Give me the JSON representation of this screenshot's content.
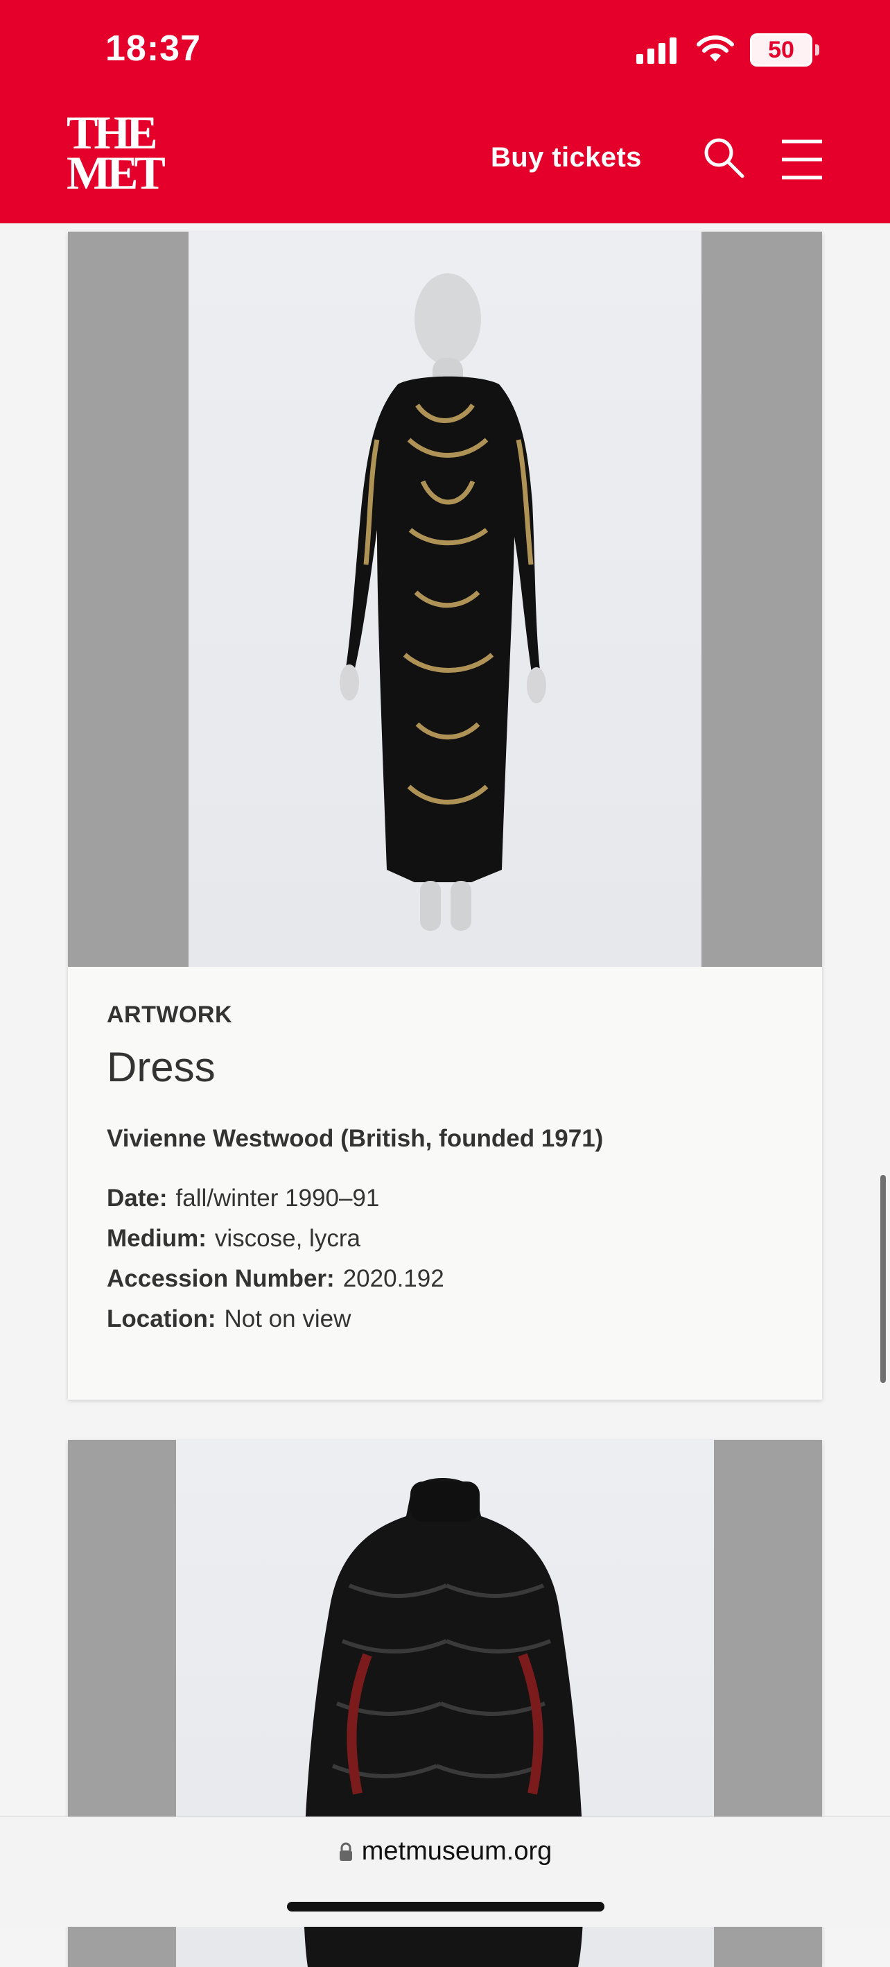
{
  "status_bar": {
    "time": "18:37",
    "battery": "50"
  },
  "header": {
    "logo_line1": "THE",
    "logo_line2": "MET",
    "buy_tickets": "Buy tickets",
    "icons": [
      "search-icon",
      "menu-icon"
    ],
    "colors": {
      "brand": "#e4002b"
    }
  },
  "cards": [
    {
      "label": "ARTWORK",
      "title": "Dress",
      "maker": "Vivienne Westwood (British, founded 1971)",
      "facts": [
        {
          "label": "Date:",
          "value": "fall/winter 1990–91"
        },
        {
          "label": "Medium:",
          "value": "viscose, lycra"
        },
        {
          "label": "Accession Number:",
          "value": "2020.192"
        },
        {
          "label": "Location:",
          "value": "Not on view"
        }
      ]
    }
  ],
  "browser": {
    "url": "metmuseum.org"
  }
}
